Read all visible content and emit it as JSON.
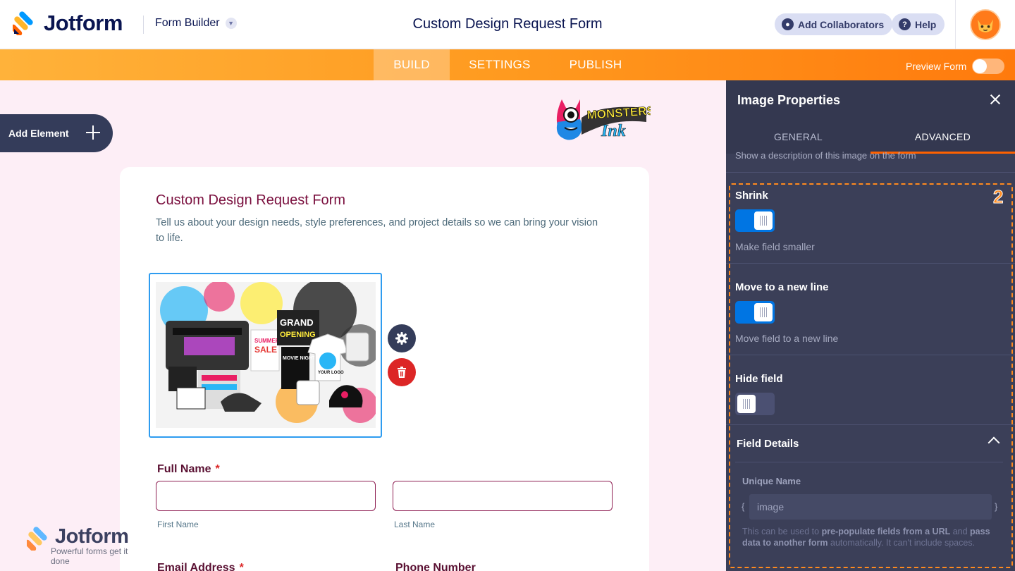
{
  "header": {
    "brand": "Jotform",
    "builder_label": "Form Builder",
    "form_title": "Custom Design Request Form",
    "add_collaborators": "Add Collaborators",
    "help": "Help"
  },
  "tabs": {
    "build": "BUILD",
    "settings": "SETTINGS",
    "publish": "PUBLISH",
    "active": "BUILD"
  },
  "preview": {
    "label": "Preview Form",
    "enabled": false
  },
  "add_element": {
    "label": "Add Element"
  },
  "brand_logo": {
    "alt": "Monsters Ink"
  },
  "form": {
    "title": "Custom Design Request Form",
    "description": "Tell us about your design needs, style preferences, and project details so we can bring your vision to life.",
    "full_name": {
      "label": "Full Name",
      "required_mark": "*",
      "first_sub": "First Name",
      "last_sub": "Last Name"
    },
    "email_label": "Email Address",
    "phone_label": "Phone Number",
    "image_text": {
      "sign_line1": "GRAND",
      "sign_line2": "OPENING",
      "summer": "SUMMER",
      "sale": "SALE",
      "your_logo": "YOUR LOGO",
      "movie_night": "MOVIE NIGHT"
    }
  },
  "watermark": {
    "brand": "Jotform",
    "tagline": "Powerful forms get it done"
  },
  "panel": {
    "title": "Image Properties",
    "tab_general": "GENERAL",
    "tab_advanced": "ADVANCED",
    "active_tab": "ADVANCED",
    "cut_description": "Show a description of this image on the form",
    "shrink": {
      "label": "Shrink",
      "help": "Make field smaller",
      "on": true
    },
    "new_line": {
      "label": "Move to a new line",
      "help": "Move field to a new line",
      "on": true
    },
    "hide": {
      "label": "Hide field",
      "on": false
    },
    "field_details": {
      "title": "Field Details",
      "unique_name_label": "Unique Name",
      "brace_open": "{",
      "brace_close": "}",
      "unique_name_value": "image",
      "help_pre": "This can be used to ",
      "help_bold1": "pre-populate fields from a URL",
      "help_mid": " and ",
      "help_bold2": "pass data to another form",
      "help_post": " automatically. It can't include spaces."
    }
  },
  "annotation": {
    "label": "2",
    "color": "#ff8a1e"
  },
  "colors": {
    "accent_orange": "#ff6100",
    "toggle_blue": "#0075e3",
    "selection_blue": "#2e9cf0",
    "delete_red": "#dc2626",
    "form_title": "#7a0f3e"
  }
}
